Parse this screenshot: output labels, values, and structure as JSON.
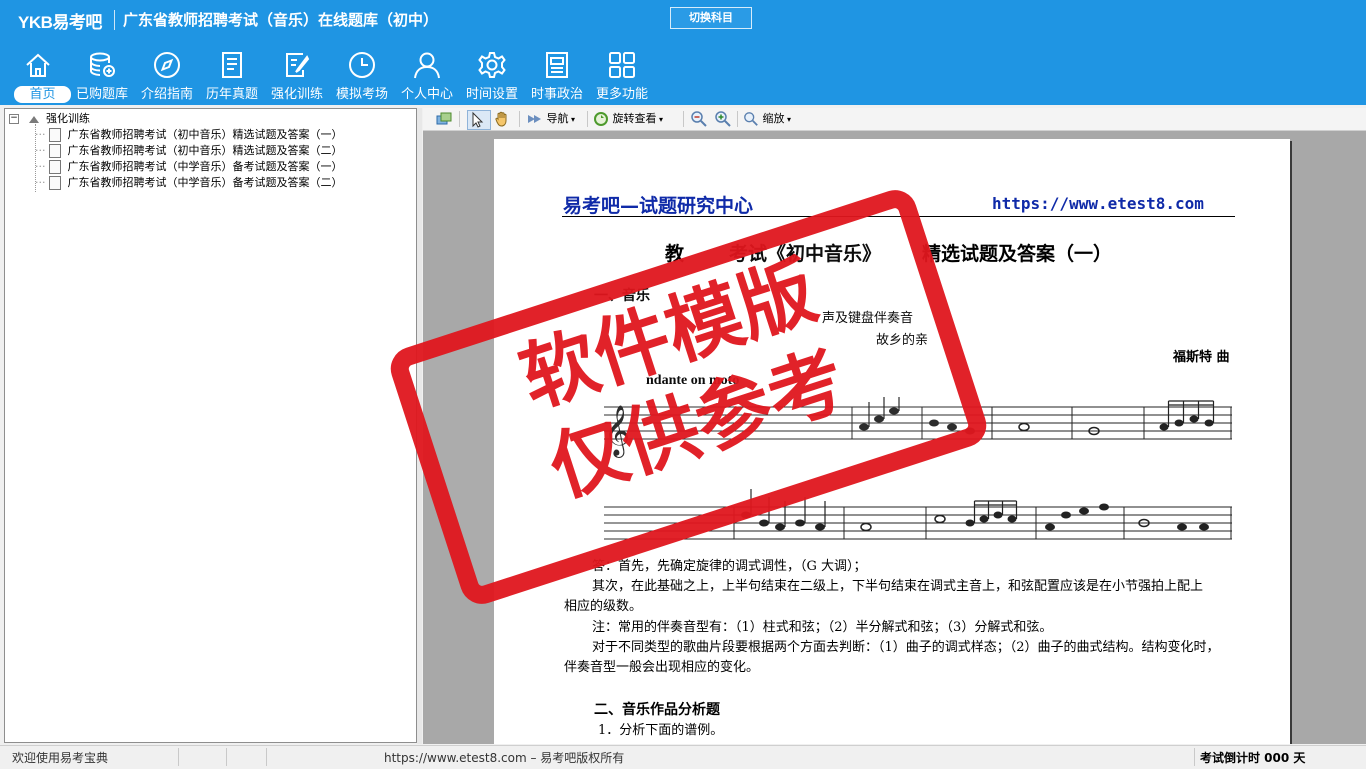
{
  "app": {
    "logo": "YKB易考吧",
    "title": "广东省教师招聘考试（音乐）在线题库（初中）",
    "switch_label": "切换科目"
  },
  "nav": [
    {
      "label": "首页",
      "icon": "home-icon"
    },
    {
      "label": "已购题库",
      "icon": "database-icon"
    },
    {
      "label": "介绍指南",
      "icon": "compass-icon"
    },
    {
      "label": "历年真题",
      "icon": "document-list-icon"
    },
    {
      "label": "强化训练",
      "icon": "edit-icon"
    },
    {
      "label": "模拟考场",
      "icon": "clock-icon"
    },
    {
      "label": "个人中心",
      "icon": "user-icon"
    },
    {
      "label": "时间设置",
      "icon": "gear-icon"
    },
    {
      "label": "时事政治",
      "icon": "newspaper-icon"
    },
    {
      "label": "更多功能",
      "icon": "grid-icon"
    }
  ],
  "tree": {
    "root": "强化训练",
    "items": [
      "广东省教师招聘考试（初中音乐）精选试题及答案（一）",
      "广东省教师招聘考试（初中音乐）精选试题及答案（二）",
      "广东省教师招聘考试（中学音乐）备考试题及答案（一）",
      "广东省教师招聘考试（中学音乐）备考试题及答案（二）"
    ]
  },
  "toolbar": {
    "navigate": "导航",
    "rotate": "旋转查看",
    "zoom": "缩放"
  },
  "document": {
    "header_left": "易考吧—试题研究中心",
    "header_right": "https://www.etest8.com",
    "title_a": "教",
    "title_b": "考试《初中音乐》",
    "title_c": "精选试题及答案（一）",
    "section1": "一、音乐",
    "accomp_a": "声及键盘伴奏音",
    "accomp_b": "故乡的亲",
    "composer": "福斯特 曲",
    "tempo": "ndante on moto",
    "answer1": "答：首先，先确定旋律的调式调性，（G 大调）；",
    "answer2": "其次，在此基础之上，上半句结束在二级上，下半句结束在调式主音上，和弦配置应该是在小节强拍上配上",
    "answer3": "相应的级数。",
    "note1": "注：常用的伴奏音型有：（1）柱式和弦；（2）半分解式和弦；（3）分解式和弦。",
    "note2": "对于不同类型的歌曲片段要根据两个方面去判断：（1）曲子的调式样态；（2）曲子的曲式结构。结构变化时，",
    "note3": "伴奏音型一般会出现相应的变化。",
    "section2": "二、音乐作品分析题",
    "q1": "1．分析下面的谱例。"
  },
  "stamp": {
    "line1": "软件模版",
    "line2": "仅供参考",
    "color": "#e0171e"
  },
  "status": {
    "welcome": "欢迎使用易考宝典",
    "copyright": "https://www.etest8.com – 易考吧版权所有",
    "countdown": "考试倒计时 000 天"
  },
  "colors": {
    "header": "#1f95e3",
    "doc_header_blue": "#0f2aa8"
  }
}
